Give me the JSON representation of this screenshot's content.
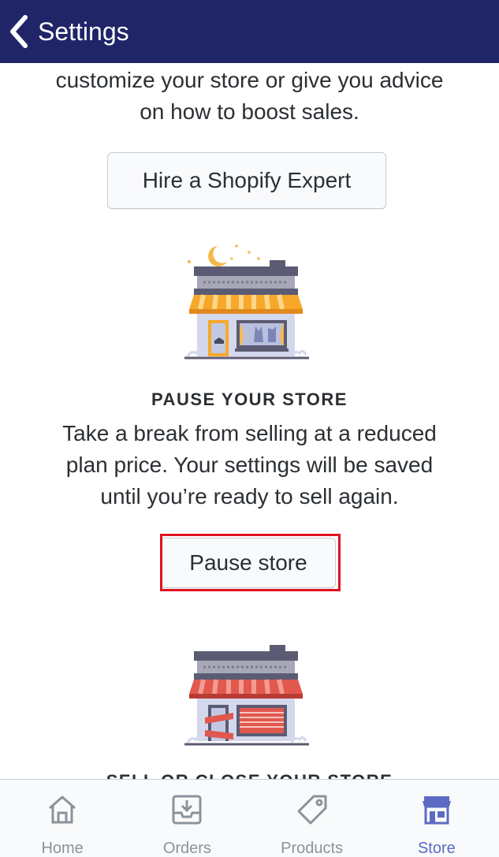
{
  "header": {
    "back_label": "Settings"
  },
  "intro": {
    "line1": "customize your store or give you advice",
    "line2": "on how to boost sales."
  },
  "hire_button": {
    "label": "Hire a Shopify Expert"
  },
  "pause_section": {
    "heading": "PAUSE YOUR STORE",
    "line1": "Take a break from selling at a reduced",
    "line2": "plan price. Your settings will be saved",
    "line3": "until you’re ready to sell again.",
    "button_label": "Pause store"
  },
  "close_section": {
    "heading": "SELL OR CLOSE YOUR STORE"
  },
  "tabs": [
    {
      "label": "Home",
      "icon": "home-icon"
    },
    {
      "label": "Orders",
      "icon": "orders-icon"
    },
    {
      "label": "Products",
      "icon": "products-icon"
    },
    {
      "label": "Store",
      "icon": "store-icon",
      "active": true
    }
  ],
  "colors": {
    "nav_background": "#1f2567",
    "highlight_border": "#e0141e",
    "tab_active": "#5c6ac4",
    "tab_inactive": "#8a939b"
  }
}
